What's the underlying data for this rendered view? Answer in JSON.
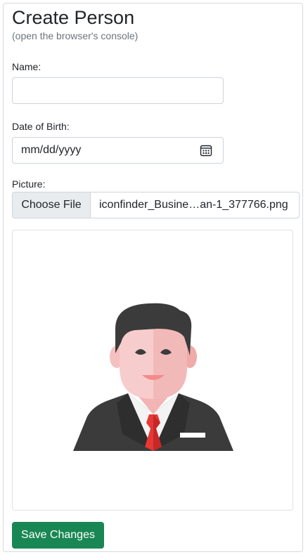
{
  "form": {
    "title": "Create Person",
    "subtitle": "(open the browser's console)",
    "name_label": "Name:",
    "name_value": "",
    "dob_label": "Date of Birth:",
    "dob_placeholder": "mm/dd/yyyy",
    "picture_label": "Picture:",
    "choose_file_label": "Choose File",
    "file_name": "iconfinder_Busine…an-1_377766.png",
    "save_label": "Save Changes"
  },
  "icons": {
    "calendar": "calendar-icon",
    "preview": "businessman-avatar"
  },
  "colors": {
    "primary_success": "#198754",
    "border": "#ced4da",
    "muted_text": "#6c757d"
  }
}
